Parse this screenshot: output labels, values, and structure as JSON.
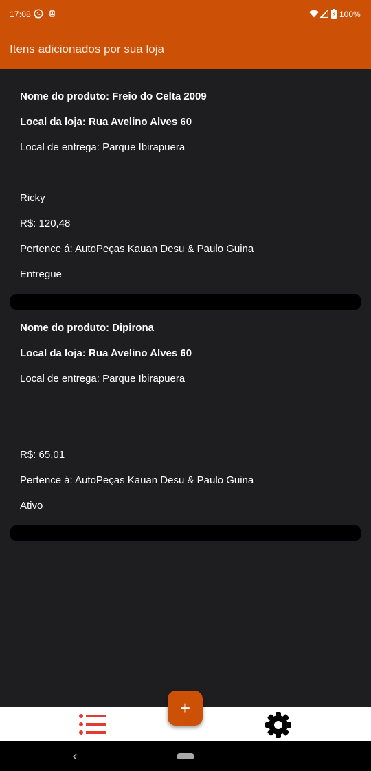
{
  "status_bar": {
    "time": "17:08",
    "battery": "100%",
    "icons": [
      "whatsapp-icon",
      "notification-icon",
      "wifi-icon",
      "signal-icon",
      "battery-icon"
    ]
  },
  "app_bar": {
    "title": "Itens adicionados por sua loja"
  },
  "items": [
    {
      "product": "Nome do produto: Freio do Celta 2009",
      "store_location": "Local da loja: Rua Avelino Alves 60",
      "delivery_location": "Local de entrega: Parque Ibirapuera",
      "customer": "Ricky",
      "price": "R$: 120,48",
      "owner": "Pertence á: AutoPeças Kauan Desu & Paulo Guina",
      "status": "Entregue"
    },
    {
      "product": "Nome do produto: Dipirona",
      "store_location": "Local da loja: Rua Avelino Alves 60",
      "delivery_location": "Local de entrega: Parque Ibirapuera",
      "customer": "",
      "price": "R$: 65,01",
      "owner": "Pertence á: AutoPeças Kauan Desu & Paulo Guina",
      "status": "Ativo"
    }
  ],
  "fab": {
    "label": "+"
  },
  "bottom_nav": {
    "icons": [
      "list-icon",
      "gear-icon"
    ]
  },
  "colors": {
    "primary": "#cc5106",
    "background": "#1e1e21",
    "list_icon": "#e53935"
  }
}
